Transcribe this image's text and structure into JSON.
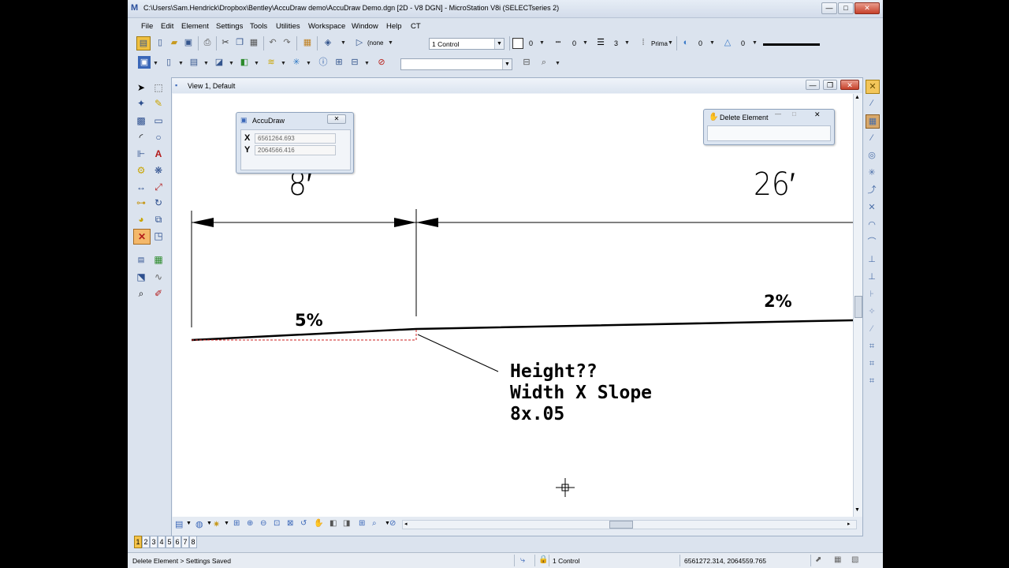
{
  "window": {
    "title": "C:\\Users\\Sam.Hendrick\\Dropbox\\Bentley\\AccuDraw demo\\AccuDraw Demo.dgn [2D - V8 DGN] - MicroStation V8i (SELECTseries 2)",
    "minimize": "—",
    "maximize": "□",
    "close": "✕"
  },
  "menu": [
    "File",
    "Edit",
    "Element",
    "Settings",
    "Tools",
    "Utilities",
    "Workspace",
    "Window",
    "Help",
    "CT"
  ],
  "toolbar": {
    "view_display": "(none",
    "level": "1 Control",
    "color_value": "0",
    "style_value": "0",
    "weight_value": "3",
    "class_value": "Prima",
    "transparency_value": "0",
    "priority_value": "0",
    "search_combo": ""
  },
  "view": {
    "title": "View 1, Default",
    "tabs": [
      "1",
      "2",
      "3",
      "4",
      "5",
      "6",
      "7",
      "8"
    ]
  },
  "accudraw": {
    "title": "AccuDraw",
    "x_label": "X",
    "x_value": "6561264.693",
    "y_label": "Y",
    "y_value": "2064566.416",
    "close": "✕"
  },
  "delete_dialog": {
    "title": "Delete Element",
    "close": "✕"
  },
  "drawing": {
    "dim_left": "8′",
    "dim_right": "26′",
    "slope_left": "5%",
    "slope_right": "2%",
    "note_line1": "Height??",
    "note_line2": "Width X Slope",
    "note_line3": "8x.05"
  },
  "status": {
    "message": "Delete Element > Settings Saved",
    "level": "1 Control",
    "coords": "6561272.314, 2064559.765"
  },
  "colors": {
    "app_bg": "#dbe3ee",
    "canvas": "#ffffff",
    "close_red": "#c6412b",
    "dashed_red": "#cc2222"
  }
}
